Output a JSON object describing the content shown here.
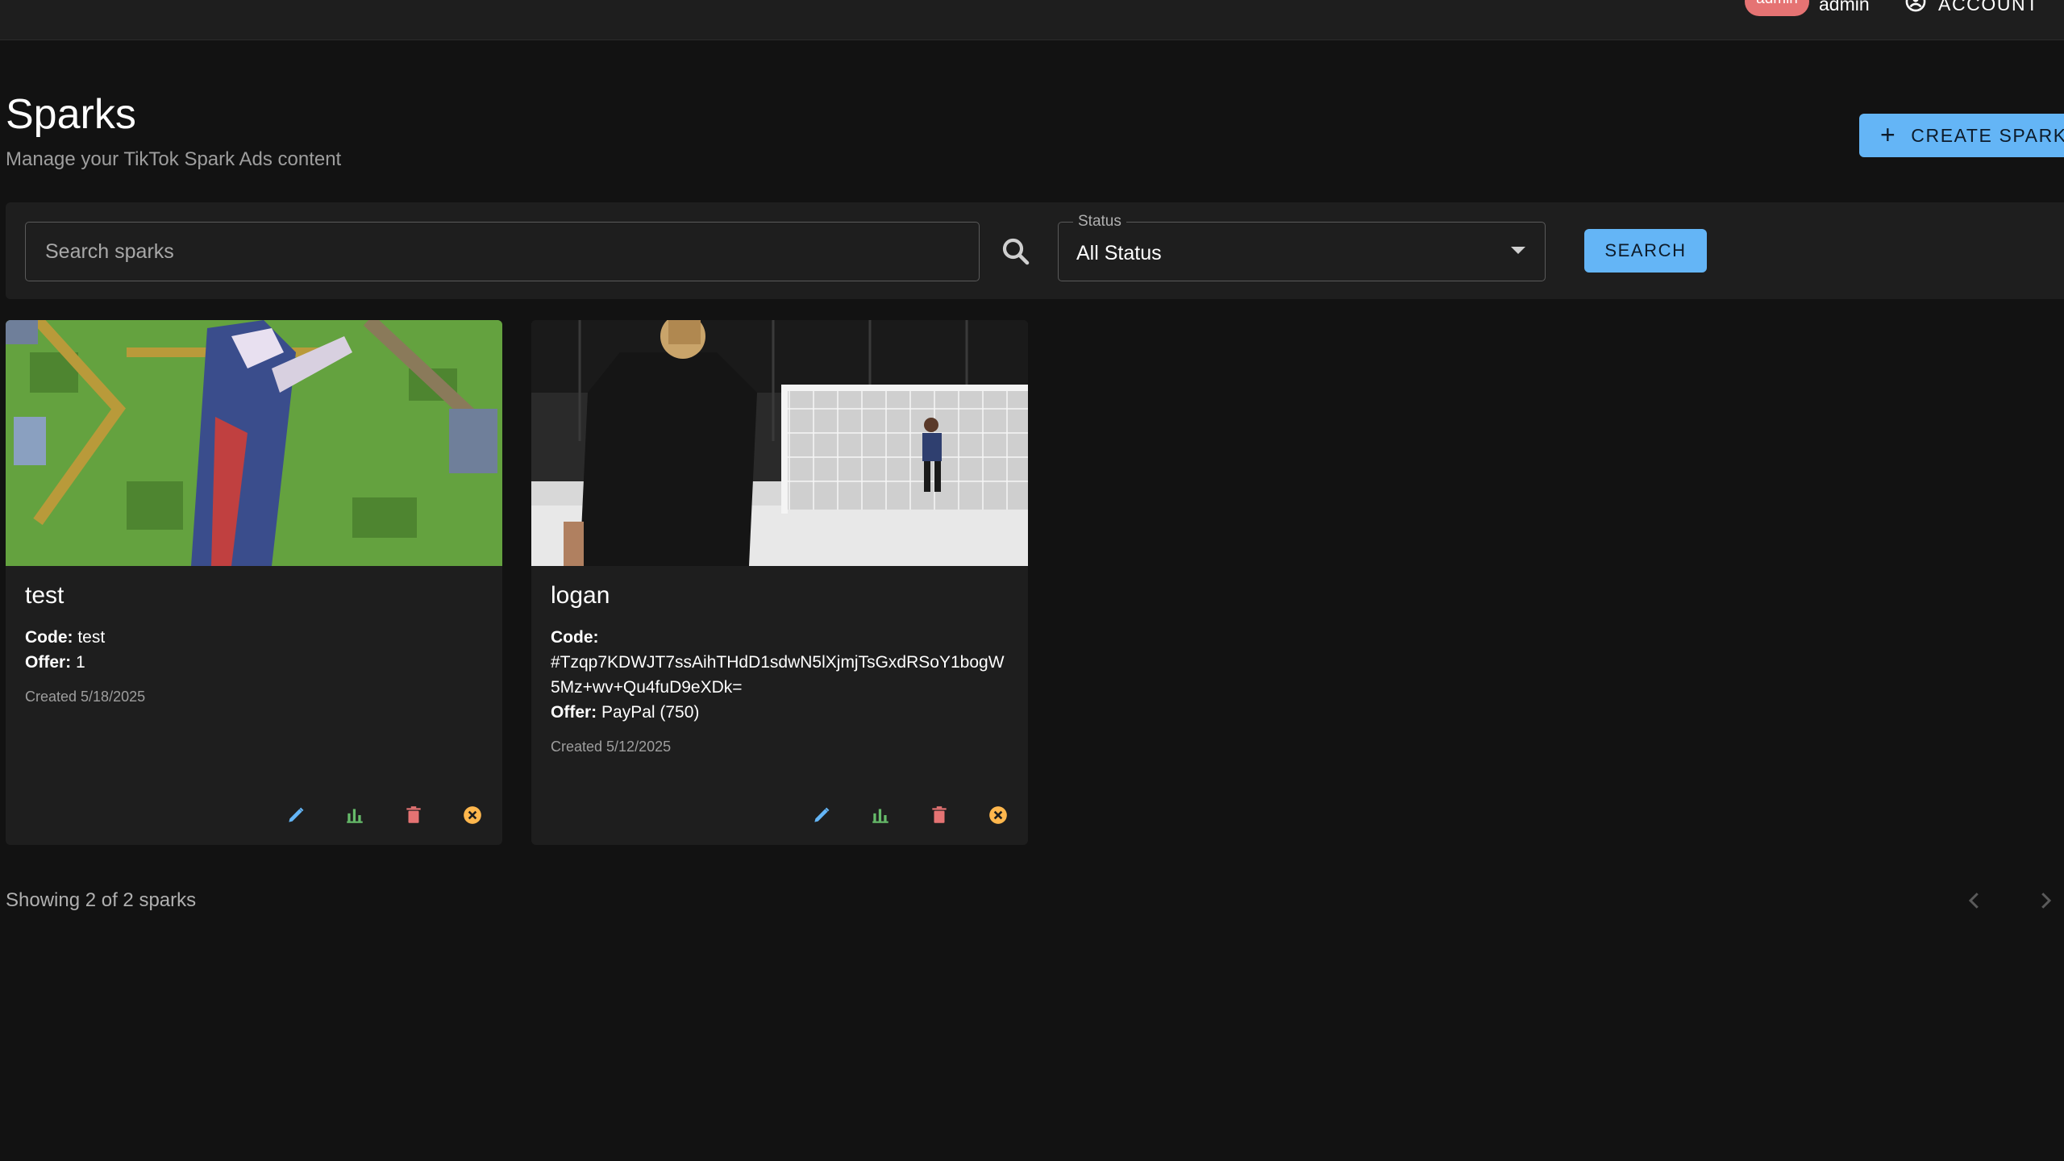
{
  "appbar": {
    "role_badge": "admin",
    "username": "admin",
    "account_label": "ACCOUNT"
  },
  "header": {
    "title": "Sparks",
    "subtitle": "Manage your TikTok Spark Ads content",
    "create_label": "CREATE SPARK"
  },
  "filters": {
    "search_placeholder": "Search sparks",
    "search_value": "",
    "status_label": "Status",
    "status_value": "All Status",
    "search_button": "SEARCH"
  },
  "cards": [
    {
      "title": "test",
      "code_label": "Code:",
      "code": "test",
      "offer_label": "Offer:",
      "offer": "1",
      "created": "Created 5/18/2025",
      "thumbnail": "game-scene-thumbnail"
    },
    {
      "title": "logan",
      "code_label": "Code:",
      "code": "#Tzqp7KDWJT7ssAihTHdD1sdwN5lXjmjTsGxdRSoY1bogW5Mz+wv+Qu4fuD9eXDk=",
      "offer_label": "Offer:",
      "offer": "PayPal (750)",
      "created": "Created 5/12/2025",
      "thumbnail": "soccer-goal-thumbnail"
    }
  ],
  "footer": {
    "showing": "Showing 2 of 2 sparks"
  },
  "colors": {
    "background": "#121212",
    "surface": "#1e1e1e",
    "primary": "#64b5f6",
    "edit": "#64b5f6",
    "stats": "#66bb6a",
    "delete": "#e57373",
    "deactivate": "#ffb74d",
    "badge": "#e57373"
  },
  "icons": {
    "account": "account-circle-icon",
    "create": "plus-icon",
    "search": "search-icon",
    "status_dropdown": "chevron-down-icon",
    "edit": "pencil-icon",
    "stats": "bar-chart-icon",
    "delete": "trash-icon",
    "deactivate": "cancel-circle-icon",
    "prev": "chevron-left-icon",
    "next": "chevron-right-icon"
  }
}
